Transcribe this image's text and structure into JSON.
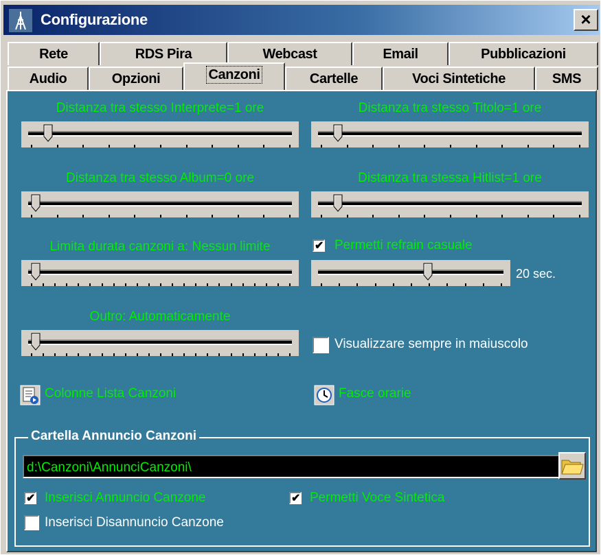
{
  "window": {
    "title": "Configurazione",
    "close_label": "×"
  },
  "tabs_row1": [
    "Rete",
    "RDS Pira",
    "Webcast",
    "Email",
    "Pubblicazioni"
  ],
  "tabs_row2": [
    "Audio",
    "Opzioni",
    "Canzoni",
    "Cartelle",
    "Voci Sintetiche",
    "SMS"
  ],
  "active_tab": "Canzoni",
  "colors": {
    "panel": "#347a9a",
    "accent_text": "#00ee00",
    "titlebar": "#0a246a"
  },
  "settings": {
    "interprete": {
      "label": "Distanza tra stesso Interprete=1 ore",
      "value_fraction": 0.05
    },
    "titolo": {
      "label": "Distanza tra stesso Titolo=1 ore",
      "value_fraction": 0.05
    },
    "album": {
      "label": "Distanza tra stesso Album=0 ore",
      "value_fraction": 0.0
    },
    "hitlist": {
      "label": "Distanza tra stessa Hitlist=1 ore",
      "value_fraction": 0.05
    },
    "durata": {
      "label": "Limita durata canzoni a: Nessun limite",
      "value_fraction": 0.0
    },
    "refrain": {
      "label": "Permetti refrain casuale",
      "checked": true,
      "value_fraction": 0.6,
      "value_text": "20 sec."
    },
    "outro": {
      "label": "Outro: Automaticamente",
      "value_fraction": 0.0
    },
    "maiuscolo": {
      "label": "Visualizzare sempre in maiuscolo",
      "checked": false
    }
  },
  "buttons": {
    "colonne": "Colonne Lista Canzoni",
    "fasce": "Fasce orarie"
  },
  "annuncio": {
    "group_title": "Cartella Annuncio Canzoni",
    "path": "d:\\Canzoni\\AnnunciCanzoni\\",
    "inserisci_annuncio": {
      "label": "Inserisci Annuncio Canzone",
      "checked": true
    },
    "voce_sintetica": {
      "label": "Permetti Voce Sintetica",
      "checked": true
    },
    "disannuncio": {
      "label": "Inserisci Disannuncio Canzone",
      "checked": false
    }
  }
}
